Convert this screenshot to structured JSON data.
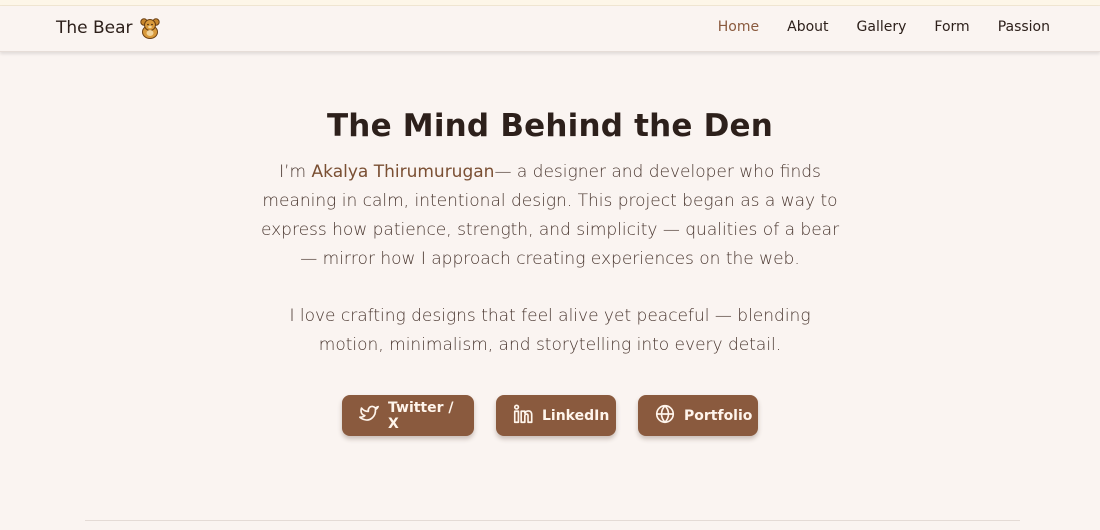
{
  "nav": {
    "brand": "The Bear",
    "brand_icon": "bear-icon",
    "links": [
      "Home",
      "About",
      "Gallery",
      "Form",
      "Passion"
    ],
    "active": "Home"
  },
  "hero": {
    "title": "The Mind Behind the Den",
    "para1_prefix": "I’m ",
    "name": "Akalya Thirumurugan",
    "para1_rest": "— a designer and developer who finds meaning in calm, intentional design. This project began as a way to express how patience, strength, and simplicity — qualities of a bear — mirror how I approach creating experiences on the web.",
    "para2": "I love crafting designs that feel alive yet peaceful — blending motion, minimalism, and storytelling into every detail."
  },
  "buttons": [
    {
      "label": "Twitter / X",
      "icon": "twitter-icon"
    },
    {
      "label": "LinkedIn",
      "icon": "linkedin-icon"
    },
    {
      "label": "Portfolio",
      "icon": "globe-icon"
    }
  ],
  "colors": {
    "background": "#faf4f1",
    "accent": "#8a5a3e",
    "text": "#2d201b"
  }
}
